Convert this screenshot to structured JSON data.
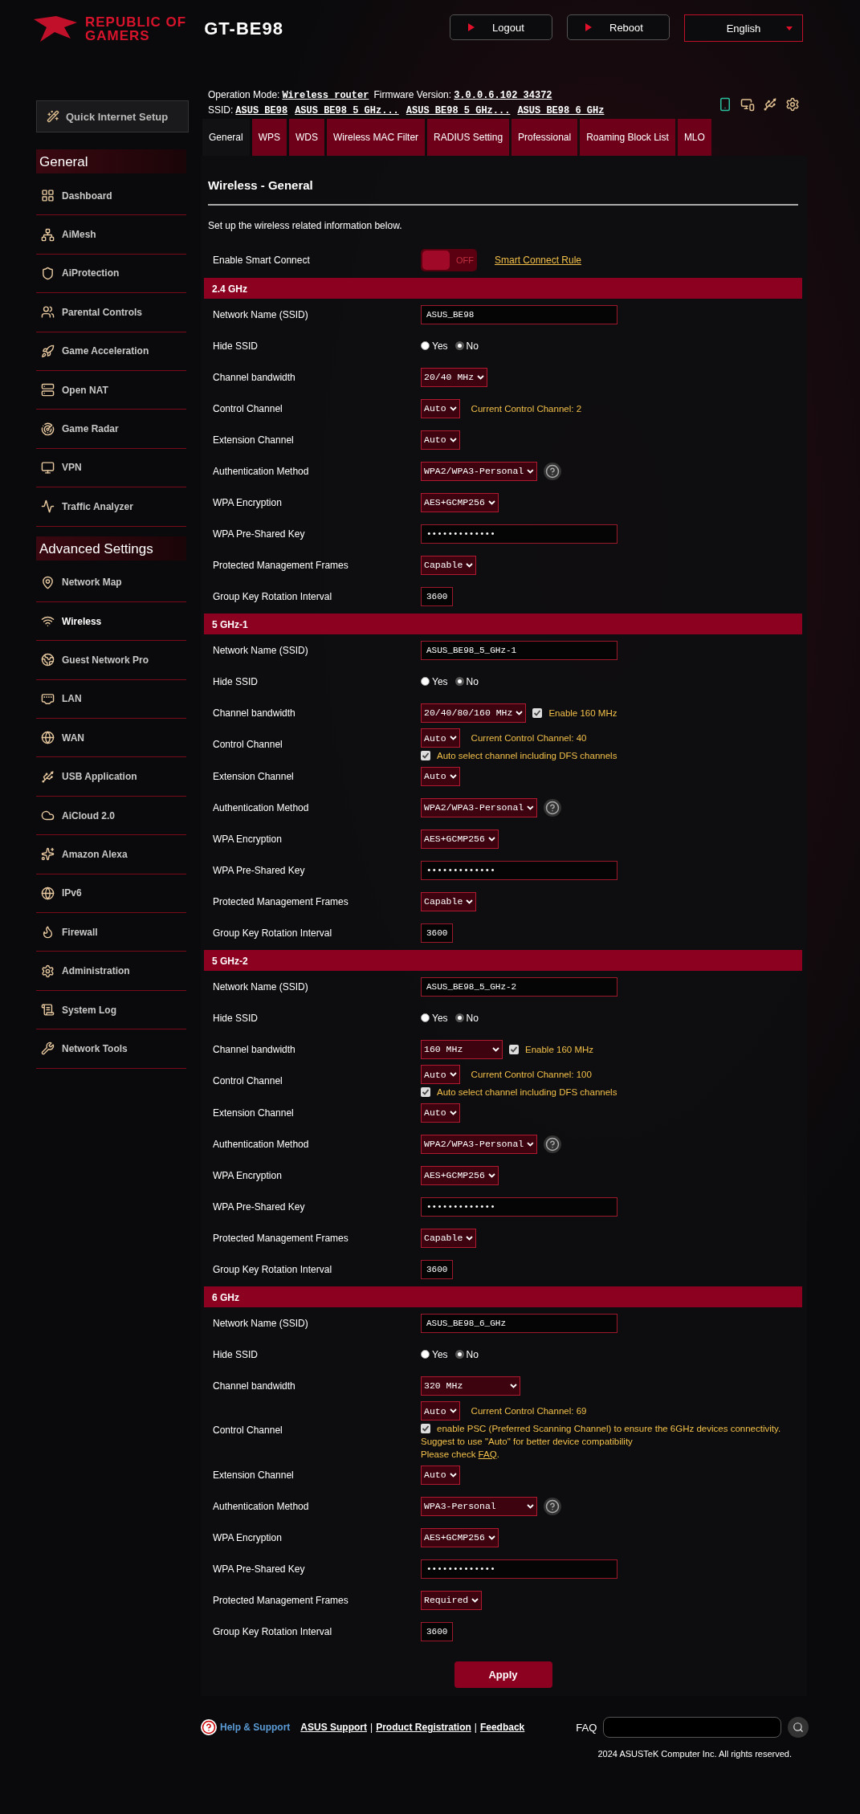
{
  "brand": {
    "line1": "REPUBLIC OF",
    "line2": "GAMERS",
    "model": "GT-BE98"
  },
  "header_buttons": [
    {
      "label": "Logout"
    },
    {
      "label": "Reboot"
    }
  ],
  "language": "English",
  "info": {
    "mode_label": "Operation Mode:",
    "mode": "Wireless router",
    "fw_label": "Firmware Version:",
    "fw": "3.0.0.6.102_34372",
    "ssid_label": "SSID:",
    "ssids": [
      "ASUS_BE98",
      "ASUS_BE98_5_GHz...",
      "ASUS_BE98_5_GHz...",
      "ASUS_BE98_6_GHz"
    ]
  },
  "status_icons": [
    {
      "kind": "phone"
    },
    {
      "kind": "monitors"
    },
    {
      "kind": "usb"
    },
    {
      "kind": "gear"
    }
  ],
  "sidebar": {
    "quick_setup": "Quick Internet Setup",
    "groups": [
      {
        "title": "General",
        "items": [
          {
            "label": "Dashboard",
            "selected": false
          },
          {
            "label": "AiMesh",
            "selected": false
          },
          {
            "label": "AiProtection",
            "selected": false
          },
          {
            "label": "Parental Controls",
            "selected": false
          },
          {
            "label": "Game Acceleration",
            "selected": false
          },
          {
            "label": "Open NAT",
            "selected": false
          },
          {
            "label": "Game Radar",
            "selected": false
          },
          {
            "label": "VPN",
            "selected": false
          },
          {
            "label": "Traffic Analyzer",
            "selected": false
          }
        ]
      },
      {
        "title": "Advanced Settings",
        "items": [
          {
            "label": "Network Map",
            "selected": false
          },
          {
            "label": "Wireless",
            "selected": true
          },
          {
            "label": "Guest Network Pro",
            "selected": false
          },
          {
            "label": "LAN",
            "selected": false
          },
          {
            "label": "WAN",
            "selected": false
          },
          {
            "label": "USB Application",
            "selected": false
          },
          {
            "label": "AiCloud 2.0",
            "selected": false
          },
          {
            "label": "Amazon Alexa",
            "selected": false
          },
          {
            "label": "IPv6",
            "selected": false
          },
          {
            "label": "Firewall",
            "selected": false
          },
          {
            "label": "Administration",
            "selected": false
          },
          {
            "label": "System Log",
            "selected": false
          },
          {
            "label": "Network Tools",
            "selected": false
          }
        ]
      }
    ]
  },
  "tabs": [
    {
      "label": "General",
      "selected": true
    },
    {
      "label": "WPS",
      "selected": false
    },
    {
      "label": "WDS",
      "selected": false
    },
    {
      "label": "Wireless MAC Filter",
      "selected": false
    },
    {
      "label": "RADIUS Setting",
      "selected": false
    },
    {
      "label": "Professional",
      "selected": false
    },
    {
      "label": "Roaming Block List",
      "selected": false
    },
    {
      "label": "MLO",
      "selected": false
    }
  ],
  "page_title": "Wireless - General",
  "description": "Set up the wireless related information below.",
  "smart_connect": {
    "label": "Enable Smart Connect",
    "on": false,
    "state_text": "OFF",
    "rule_link": "Smart Connect Rule"
  },
  "bands": [
    {
      "title": "2.4 GHz",
      "rows": [
        {
          "kind": "text",
          "label": "Network Name (SSID)",
          "value": "ASUS_BE98"
        },
        {
          "kind": "radio",
          "label": "Hide SSID",
          "options": [
            {
              "label": "Yes",
              "selected": false
            },
            {
              "label": "No",
              "selected": true
            }
          ]
        },
        {
          "kind": "select",
          "label": "Channel bandwidth",
          "value": "20/40 MHz"
        },
        {
          "kind": "select",
          "label": "Control Channel",
          "value": "Auto",
          "note": "Current Control Channel: 2"
        },
        {
          "kind": "select",
          "label": "Extension Channel",
          "value": "Auto"
        },
        {
          "kind": "auth",
          "label": "Authentication Method",
          "value": "WPA2/WPA3-Personal"
        },
        {
          "kind": "select",
          "label": "WPA Encryption",
          "value": "AES+GCMP256"
        },
        {
          "kind": "password",
          "label": "WPA Pre-Shared Key",
          "value": "•••••••••••••"
        },
        {
          "kind": "select",
          "label": "Protected Management Frames",
          "value": "Capable"
        },
        {
          "kind": "number",
          "label": "Group Key Rotation Interval",
          "value": "3600"
        }
      ]
    },
    {
      "title": "5 GHz-1",
      "rows": [
        {
          "kind": "text",
          "label": "Network Name (SSID)",
          "value": "ASUS_BE98_5_GHz-1"
        },
        {
          "kind": "radio",
          "label": "Hide SSID",
          "options": [
            {
              "label": "Yes",
              "selected": false
            },
            {
              "label": "No",
              "selected": true
            }
          ]
        },
        {
          "kind": "select",
          "label": "Channel bandwidth",
          "value": "20/40/80/160 MHz",
          "check": {
            "label": "Enable 160 MHz",
            "checked": true
          }
        },
        {
          "kind": "select",
          "label": "Control Channel",
          "value": "Auto",
          "note": "Current Control Channel: 40",
          "check": {
            "label": "Auto select channel including DFS channels",
            "checked": true
          }
        },
        {
          "kind": "select",
          "label": "Extension Channel",
          "value": "Auto"
        },
        {
          "kind": "auth",
          "label": "Authentication Method",
          "value": "WPA2/WPA3-Personal"
        },
        {
          "kind": "select",
          "label": "WPA Encryption",
          "value": "AES+GCMP256"
        },
        {
          "kind": "password",
          "label": "WPA Pre-Shared Key",
          "value": "•••••••••••••"
        },
        {
          "kind": "select",
          "label": "Protected Management Frames",
          "value": "Capable"
        },
        {
          "kind": "number",
          "label": "Group Key Rotation Interval",
          "value": "3600"
        }
      ]
    },
    {
      "title": "5 GHz-2",
      "rows": [
        {
          "kind": "text",
          "label": "Network Name (SSID)",
          "value": "ASUS_BE98_5_GHz-2"
        },
        {
          "kind": "radio",
          "label": "Hide SSID",
          "options": [
            {
              "label": "Yes",
              "selected": false
            },
            {
              "label": "No",
              "selected": true
            }
          ]
        },
        {
          "kind": "wide",
          "label": "Channel bandwidth",
          "value": "160 MHz",
          "check": {
            "label": "Enable 160 MHz",
            "checked": true
          }
        },
        {
          "kind": "select",
          "label": "Control Channel",
          "value": "Auto",
          "note": "Current Control Channel: 100",
          "check": {
            "label": "Auto select channel including DFS channels",
            "checked": true
          }
        },
        {
          "kind": "select",
          "label": "Extension Channel",
          "value": "Auto"
        },
        {
          "kind": "auth",
          "label": "Authentication Method",
          "value": "WPA2/WPA3-Personal"
        },
        {
          "kind": "select",
          "label": "WPA Encryption",
          "value": "AES+GCMP256"
        },
        {
          "kind": "password",
          "label": "WPA Pre-Shared Key",
          "value": "•••••••••••••"
        },
        {
          "kind": "select",
          "label": "Protected Management Frames",
          "value": "Capable"
        },
        {
          "kind": "number",
          "label": "Group Key Rotation Interval",
          "value": "3600"
        }
      ]
    },
    {
      "title": "6 GHz",
      "rows": [
        {
          "kind": "text",
          "label": "Network Name (SSID)",
          "value": "ASUS_BE98_6_GHz"
        },
        {
          "kind": "radio",
          "label": "Hide SSID",
          "options": [
            {
              "label": "Yes",
              "selected": false
            },
            {
              "label": "No",
              "selected": true
            }
          ]
        },
        {
          "kind": "wider",
          "label": "Channel bandwidth",
          "value": "320 MHz"
        },
        {
          "kind": "select",
          "label": "Control Channel",
          "value": "Auto",
          "note": "Current Control Channel: 69",
          "check": {
            "label": "enable PSC (Preferred Scanning Channel) to ensure the 6GHz devices connectivity.",
            "checked": true
          },
          "hint": "Suggest to use \"Auto\" for better device compatibility",
          "faq": {
            "before": "Please check ",
            "link": "FAQ",
            "after": "."
          }
        },
        {
          "kind": "select",
          "label": "Extension Channel",
          "value": "Auto"
        },
        {
          "kind": "auth",
          "label": "Authentication Method",
          "value": "WPA3-Personal"
        },
        {
          "kind": "select",
          "label": "WPA Encryption",
          "value": "AES+GCMP256"
        },
        {
          "kind": "password",
          "label": "WPA Pre-Shared Key",
          "value": "•••••••••••••"
        },
        {
          "kind": "select",
          "label": "Protected Management Frames",
          "value": "Required"
        },
        {
          "kind": "number",
          "label": "Group Key Rotation Interval",
          "value": "3600"
        }
      ]
    }
  ],
  "apply": "Apply",
  "footer": {
    "help": "Help & Support",
    "links": [
      "ASUS Support",
      "Product Registration",
      "Feedback"
    ],
    "separator": "|",
    "faq_label": "FAQ",
    "copyright": "2024 ASUSTeK Computer Inc. All rights reserved."
  }
}
